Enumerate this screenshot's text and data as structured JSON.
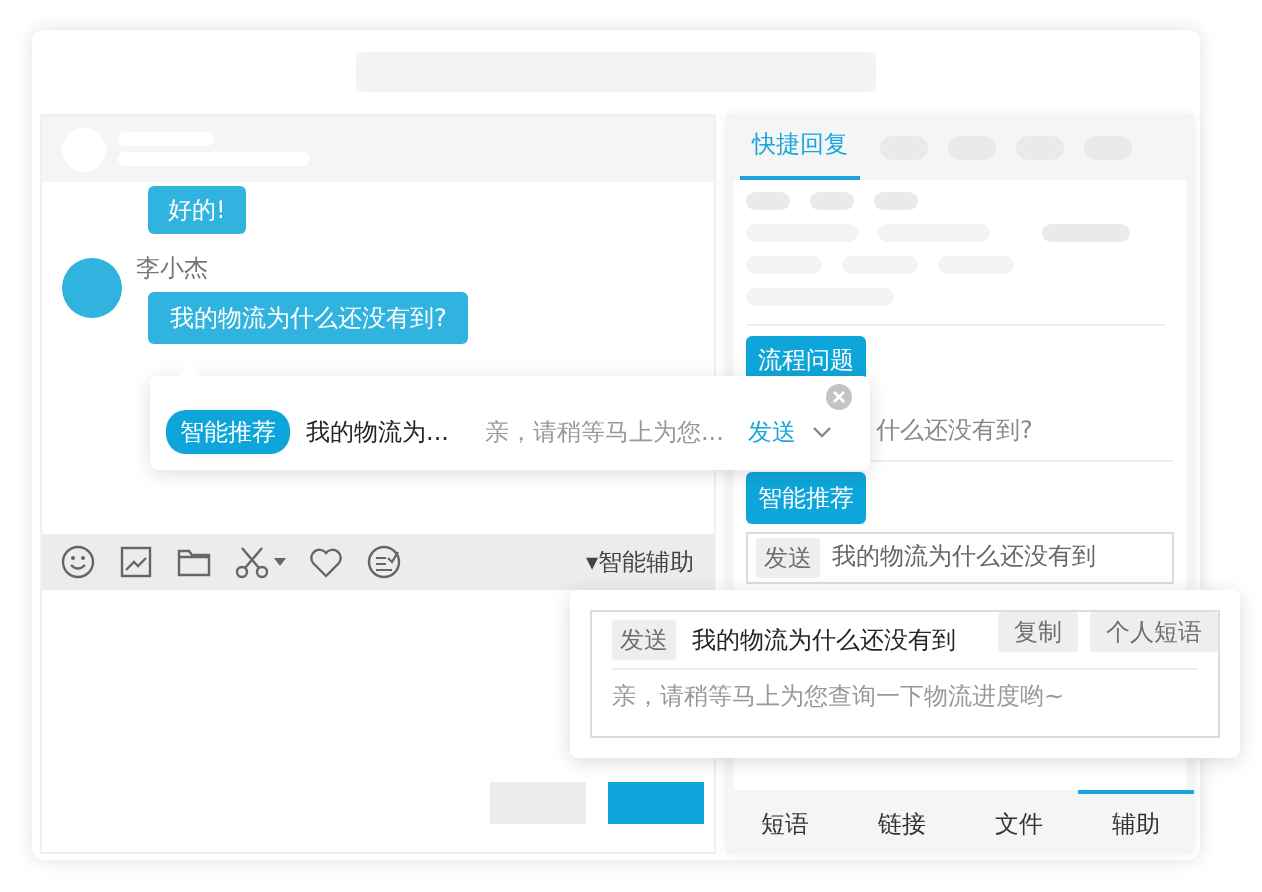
{
  "chat": {
    "messages": [
      {
        "kind": "agent",
        "text": "好的!"
      },
      {
        "kind": "customer",
        "sender": "李小杰",
        "text": "我的物流为什么还没有到?"
      }
    ],
    "suggestion": {
      "badge": "智能推荐",
      "question": "我的物流为...",
      "answer": "亲，请稍等马上为您...",
      "action": "发送"
    },
    "toolbar": {
      "assist_label": "▾智能辅助"
    }
  },
  "side_panel": {
    "tabs": [
      {
        "label": "快捷回复",
        "selected": true
      }
    ],
    "category_button": "流程问题",
    "question": "什么还没有到?",
    "recommend_button": "智能推荐",
    "reply_row": {
      "tag": "发送",
      "text": "我的物流为什么还没有到"
    },
    "bottom_tabs": [
      {
        "label": "短语",
        "selected": false
      },
      {
        "label": "链接",
        "selected": false
      },
      {
        "label": "文件",
        "selected": false
      },
      {
        "label": "辅助",
        "selected": true
      }
    ]
  },
  "reply_card": {
    "tag": "发送",
    "question": "我的物流为什么还没有到",
    "actions": [
      "复制",
      "个人短语"
    ],
    "answer": "亲，请稍等马上为您查询一下物流进度哟~"
  }
}
